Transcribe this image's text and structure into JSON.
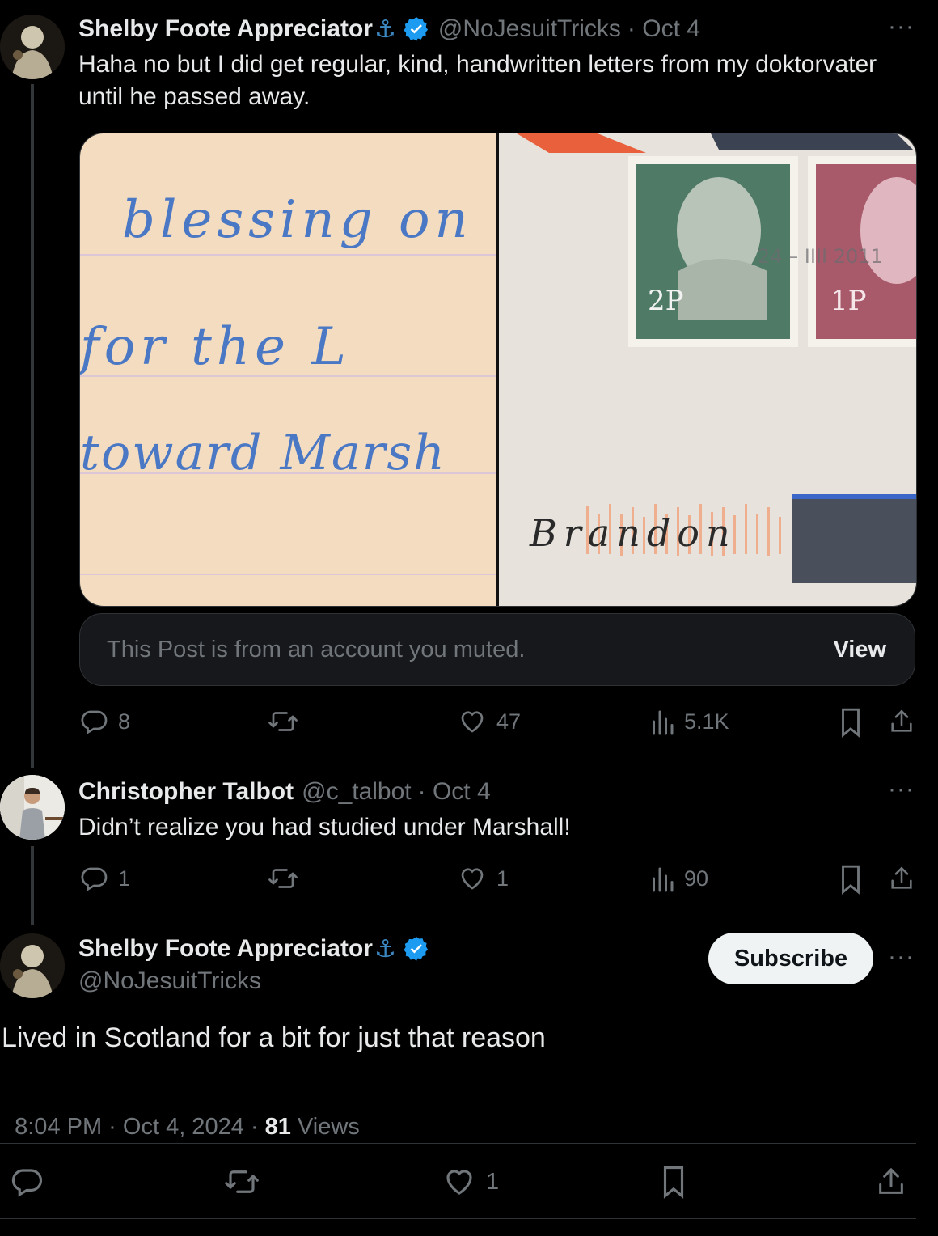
{
  "tweet1": {
    "name": "Shelby Foote Appreciator",
    "badge_emoji": "⚓",
    "handle": "@NoJesuitTricks",
    "date": "· Oct 4",
    "text": "Haha no but I did get regular, kind, handwritten letters from my doktorvater until he passed away.",
    "media": {
      "left_lines": [
        "blessing on",
        "for the L",
        "toward Marsh"
      ],
      "right_stamp_value": "2P",
      "right_stamp2_value": "1P",
      "right_postmark": "24 – IIII 2011",
      "right_name": "Brandon"
    },
    "muted_notice": "This Post is from an account you muted.",
    "muted_view": "View",
    "replies": "8",
    "likes": "47",
    "views": "5.1K"
  },
  "tweet2": {
    "name": "Christopher Talbot",
    "handle": "@c_talbot",
    "date": "· Oct 4",
    "text": "Didn’t realize you had studied under Marshall!",
    "replies": "1",
    "likes": "1",
    "views": "90"
  },
  "main": {
    "name": "Shelby Foote Appreciator",
    "badge_emoji": "⚓",
    "handle": "@NoJesuitTricks",
    "subscribe": "Subscribe",
    "text": "Lived in Scotland for a bit for just that reason",
    "time": "8:04 PM · Oct 4, 2024 · ",
    "views_count": "81",
    "views_label": " Views",
    "likes": "1"
  },
  "more_label": "···",
  "colors": {
    "verified": "#1d9bf0",
    "anchor": "#3b88c3",
    "muted_text": "#71767b"
  }
}
